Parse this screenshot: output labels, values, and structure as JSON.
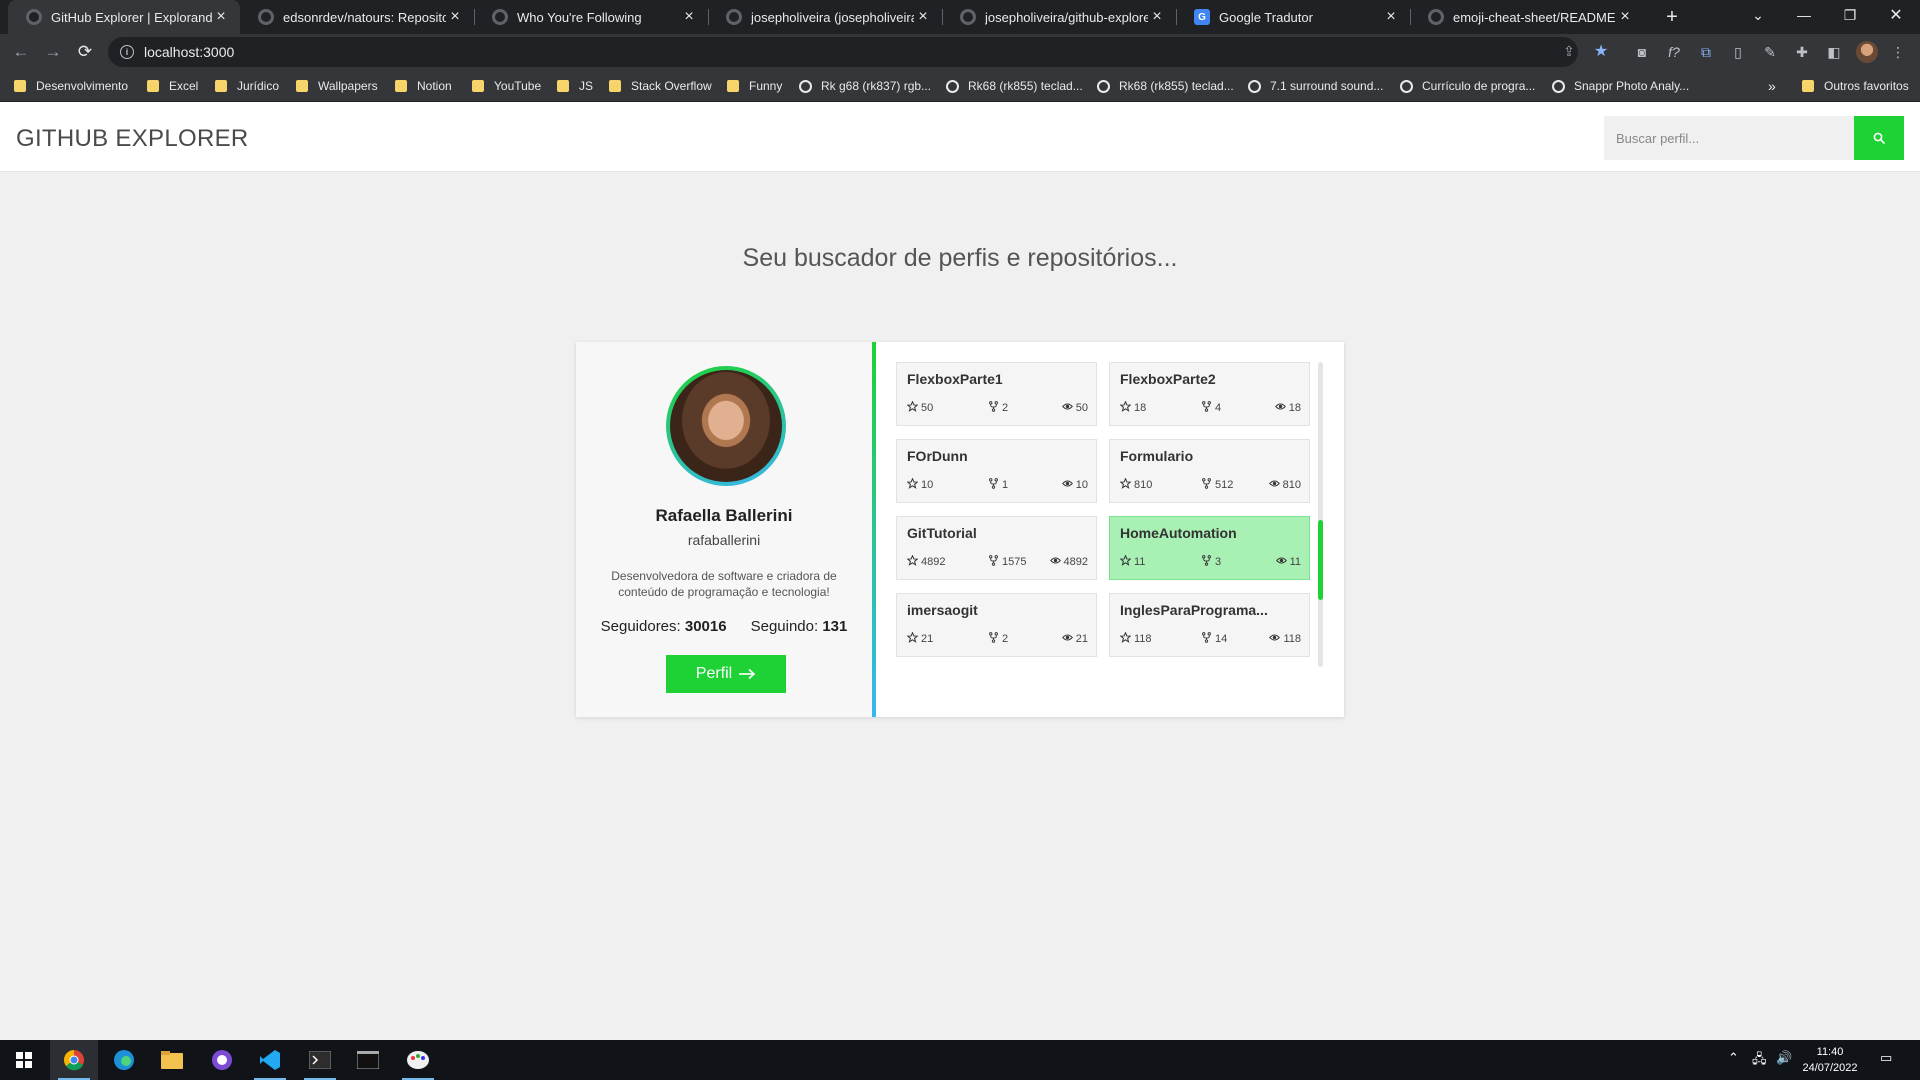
{
  "browser": {
    "tabs": [
      {
        "title": "GitHub Explorer | Explorando pe",
        "favicon": "github-icon",
        "active": true
      },
      {
        "title": "edsonrdev/natours: Repository c",
        "favicon": "github-icon"
      },
      {
        "title": "Who You're Following",
        "favicon": "github-icon"
      },
      {
        "title": "josepholiveira (josepholiveira) / I",
        "favicon": "github-icon"
      },
      {
        "title": "josepholiveira/github-explorer",
        "favicon": "github-icon"
      },
      {
        "title": "Google Tradutor",
        "favicon": "google-translate-icon"
      },
      {
        "title": "emoji-cheat-sheet/README.md",
        "favicon": "github-icon"
      }
    ],
    "url": "localhost:3000",
    "bookmarks": [
      {
        "label": "Desenvolvimento",
        "type": "folder"
      },
      {
        "label": "Excel",
        "type": "folder"
      },
      {
        "label": "Jurídico",
        "type": "folder"
      },
      {
        "label": "Wallpapers",
        "type": "folder"
      },
      {
        "label": "Notion",
        "type": "folder"
      },
      {
        "label": "YouTube",
        "type": "folder"
      },
      {
        "label": "JS",
        "type": "folder"
      },
      {
        "label": "Stack Overflow",
        "type": "folder"
      },
      {
        "label": "Funny",
        "type": "folder"
      },
      {
        "label": "Rk g68 (rk837) rgb...",
        "type": "link"
      },
      {
        "label": "Rk68 (rk855) teclad...",
        "type": "link"
      },
      {
        "label": "Rk68 (rk855) teclad...",
        "type": "link"
      },
      {
        "label": "7.1 surround sound...",
        "type": "link"
      },
      {
        "label": "Currículo de progra...",
        "type": "link"
      },
      {
        "label": "Snappr Photo Analy...",
        "type": "link"
      }
    ],
    "more_bookmarks": "»",
    "other_favorites": "Outros favoritos"
  },
  "app": {
    "brand": "GITHUB EXPLORER",
    "search": {
      "placeholder": "Buscar perfil..."
    },
    "tagline": "Seu buscador de perfis e repositórios...",
    "accent": "#1ed236",
    "accent2": "#38b6f0"
  },
  "profile": {
    "name": "Rafaella Ballerini",
    "login": "rafaballerini",
    "bio": "Desenvolvedora de software e criadora de conteúdo de programação e tecnologia!",
    "followers_label": "Seguidores:",
    "followers": "30016",
    "following_label": "Seguindo:",
    "following": "131",
    "button_label": "Perfil"
  },
  "repos": [
    {
      "name": "FlexboxParte1",
      "stars": "50",
      "forks": "2",
      "watchers": "50"
    },
    {
      "name": "FlexboxParte2",
      "stars": "18",
      "forks": "4",
      "watchers": "18"
    },
    {
      "name": "FOrDunn",
      "stars": "10",
      "forks": "1",
      "watchers": "10"
    },
    {
      "name": "Formulario",
      "stars": "810",
      "forks": "512",
      "watchers": "810"
    },
    {
      "name": "GitTutorial",
      "stars": "4892",
      "forks": "1575",
      "watchers": "4892"
    },
    {
      "name": "HomeAutomation",
      "stars": "11",
      "forks": "3",
      "watchers": "11",
      "highlighted": true
    },
    {
      "name": "imersaogit",
      "stars": "21",
      "forks": "2",
      "watchers": "21"
    },
    {
      "name": "InglesParaPrograma...",
      "stars": "118",
      "forks": "14",
      "watchers": "118"
    }
  ],
  "taskbar": {
    "time": "11:40",
    "date": "24/07/2022"
  }
}
